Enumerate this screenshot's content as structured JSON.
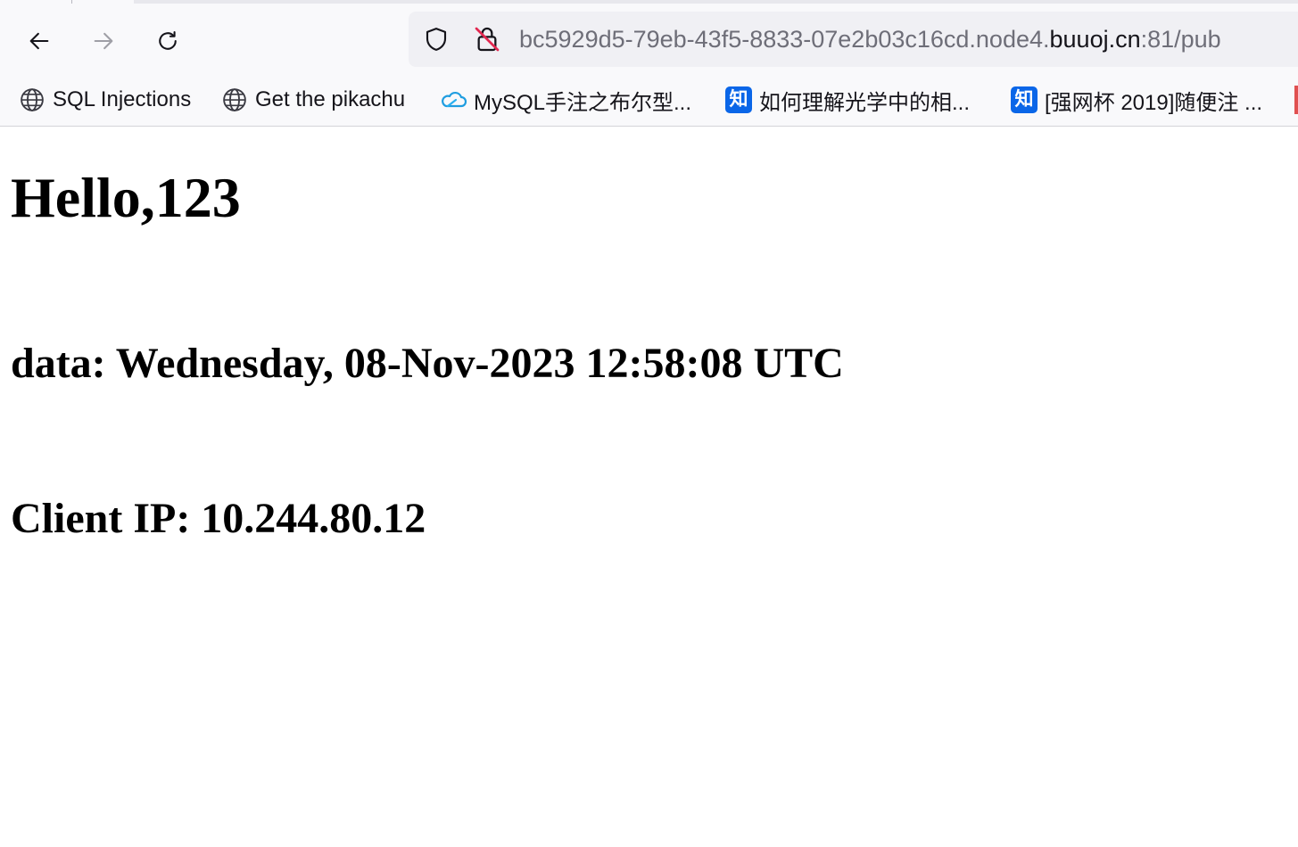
{
  "browser": {
    "url": {
      "prefix": "bc5929d5-79eb-43f5-8833-07e2b03c16cd.node4.",
      "host": "buuoj.cn",
      "suffix": ":81/pub"
    },
    "bookmarks": [
      {
        "label": "SQL Injections",
        "icon": "globe-icon"
      },
      {
        "label": "Get the pikachu",
        "icon": "globe-icon"
      },
      {
        "label": "MySQL手注之布尔型...",
        "icon": "cloud-icon"
      },
      {
        "label": "如何理解光学中的相...",
        "icon": "zhihu-icon",
        "icon_text": "知"
      },
      {
        "label": "[强网杯 2019]随便注 ...",
        "icon": "zhihu-icon",
        "icon_text": "知"
      }
    ],
    "accent": "#0a66e8"
  },
  "page": {
    "greeting": "Hello,123",
    "date_line": "data: Wednesday, 08-Nov-2023 12:58:08 UTC",
    "ip_line": "Client IP: 10.244.80.12"
  }
}
